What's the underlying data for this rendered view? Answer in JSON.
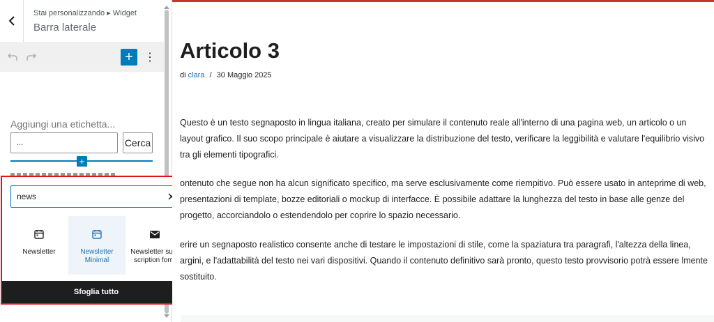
{
  "sidebar": {
    "breadcrumb": "Stai personalizzando ▸ Widget",
    "title": "Barra laterale",
    "search_widget": {
      "label": "Aggiungi una etichetta...",
      "input_value": "...",
      "button_label": "Cerca"
    }
  },
  "inserter": {
    "search_value": "news",
    "items": [
      {
        "label": "Newsletter",
        "icon": "calendar-icon"
      },
      {
        "label": "Newsletter Minimal",
        "icon": "calendar-icon"
      },
      {
        "label": "Newsletter sub-scription form",
        "icon": "envelope-icon"
      }
    ],
    "browse_all": "Sfoglia tutto",
    "highlight_color": "#e0131a"
  },
  "post": {
    "title": "Articolo 3",
    "by": "di",
    "author": "clara",
    "separator": "/",
    "date": "30 Maggio 2025",
    "paragraphs": [
      "Questo è un testo segnaposto in lingua italiana, creato per simulare il contenuto reale all'interno di una pagina web, un articolo o un layout grafico. Il suo scopo principale è aiutare a visualizzare la distribuzione del testo, verificare la leggibilità e valutare l'equilibrio visivo tra gli elementi tipografici.",
      "ontenuto che segue non ha alcun significato specifico, ma serve esclusivamente come riempitivo. Può essere usato in anteprime di web, presentazioni di template, bozze editoriali o mockup di interfacce. È possibile adattare la lunghezza del testo in base alle genze del progetto, accorciandolo o estendendolo per coprire lo spazio necessario.",
      "erire un segnaposto realistico consente anche di testare le impostazioni di stile, come la spaziatura tra paragrafi, l'altezza della linea, argini, e l'adattabilità del testo nei vari dispositivi. Quando il contenuto definitivo sarà pronto, questo testo provvisorio potrà essere lmente sostituito."
    ]
  },
  "colors": {
    "accent": "#007cba",
    "top_bar": "#c9352b"
  }
}
